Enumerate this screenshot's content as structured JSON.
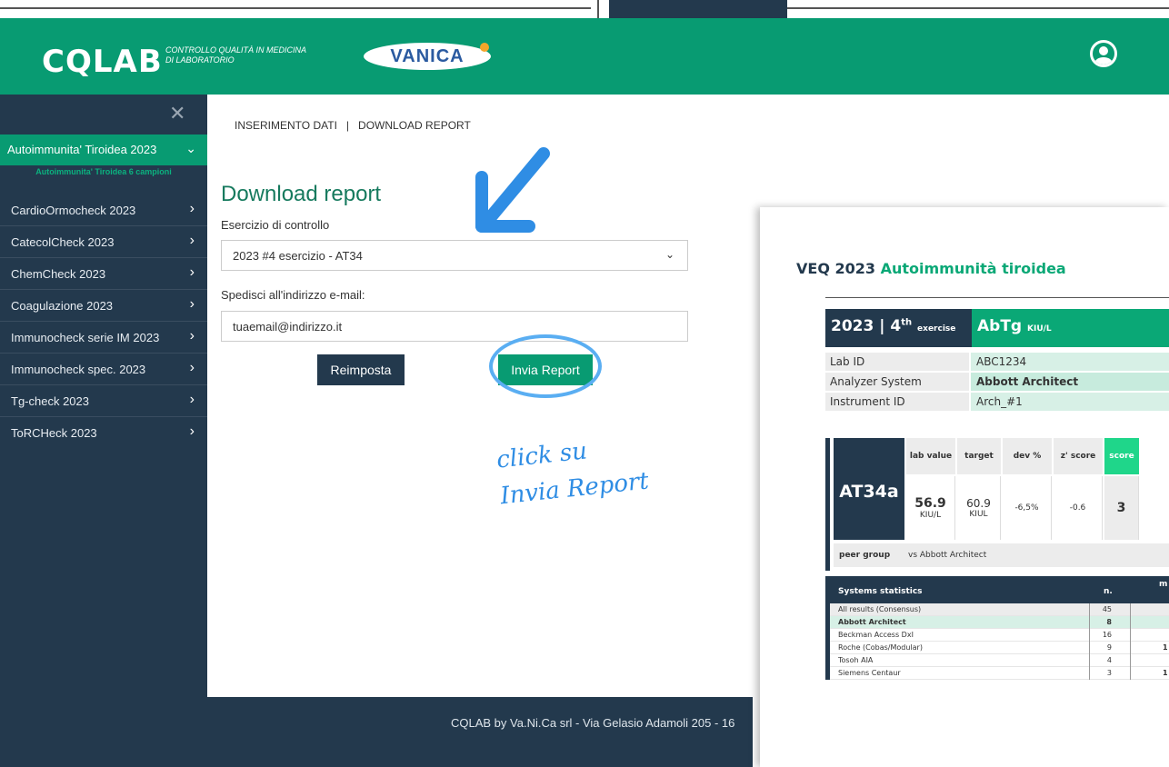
{
  "brand": {
    "logo": "CQLAB",
    "tagline_1": "CONTROLLO QUALITÀ IN MEDICINA",
    "tagline_2": "DI LABORATORIO",
    "partner_logo": "VANICA"
  },
  "sidebar": {
    "active": {
      "label": "Autoimmunita' Tiroidea 2023",
      "sub": "Autoimmunita' Tiroidea 6 campioni"
    },
    "items": [
      {
        "label": "CardioOrmocheck 2023"
      },
      {
        "label": "CatecolCheck 2023"
      },
      {
        "label": "ChemCheck 2023"
      },
      {
        "label": "Coagulazione 2023"
      },
      {
        "label": "Immunocheck serie IM 2023"
      },
      {
        "label": "Immunocheck spec. 2023"
      },
      {
        "label": "Tg-check 2023"
      },
      {
        "label": "ToRCHeck 2023"
      }
    ]
  },
  "tabs": {
    "data_entry": "INSERIMENTO DATI",
    "separator": "|",
    "download": "DOWNLOAD REPORT"
  },
  "form": {
    "title": "Download report",
    "exercise_label": "Esercizio di controllo",
    "exercise_value": "2023 #4 esercizio - AT34",
    "email_label": "Spedisci all'indirizzo e-mail:",
    "email_value": "tuaemail@indirizzo.it",
    "reset_button": "Reimposta",
    "send_button": "Invia Report"
  },
  "annotation": {
    "line1": "click su",
    "line2": "Invia Report"
  },
  "footer": {
    "text": "CQLAB by Va.Ni.Ca srl - Via Gelasio Adamoli 205 - 16"
  },
  "report": {
    "title_prefix": "VEQ 2023 ",
    "title_green": "Autoimmunità tiroidea",
    "year": "2023",
    "exercise_num": "4",
    "exercise_sup": "th",
    "exercise_word": "exercise",
    "analyte": "AbTg",
    "analyte_unit": "KIU/L",
    "info": [
      {
        "key": "Lab ID",
        "value": "ABC1234"
      },
      {
        "key": "Analyzer System",
        "value": "Abbott Architect"
      },
      {
        "key": "Instrument ID",
        "value": "Arch_#1"
      }
    ],
    "sample": "AT34a",
    "cols": {
      "lab_value": "lab value",
      "target": "target",
      "dev": "dev %",
      "z": "z' score",
      "score": "score"
    },
    "values": {
      "lab_value": "56.9",
      "lab_unit": "KIU/L",
      "target": "60.9",
      "target_unit": "KIUL",
      "dev": "-6,5%",
      "z": "-0.6",
      "score": "3"
    },
    "peer_label": "peer group",
    "peer_value": "vs Abbott Architect",
    "stats_title": "Systems statistics",
    "stats_n": "n.",
    "stats_m": "m",
    "stats": [
      {
        "name": "All results (Consensus)",
        "n": "45",
        "extra": ""
      },
      {
        "name": "Abbott Architect",
        "n": "8",
        "extra": ""
      },
      {
        "name": "Beckman Access DxI",
        "n": "16",
        "extra": ""
      },
      {
        "name": "Roche (Cobas/Modular)",
        "n": "9",
        "extra": "1"
      },
      {
        "name": "Tosoh AIA",
        "n": "4",
        "extra": ""
      },
      {
        "name": "Siemens Centaur",
        "n": "3",
        "extra": "1"
      }
    ]
  },
  "colors": {
    "green": "#089b72",
    "navy": "#23394d",
    "annotation_blue": "#2f8de4"
  }
}
